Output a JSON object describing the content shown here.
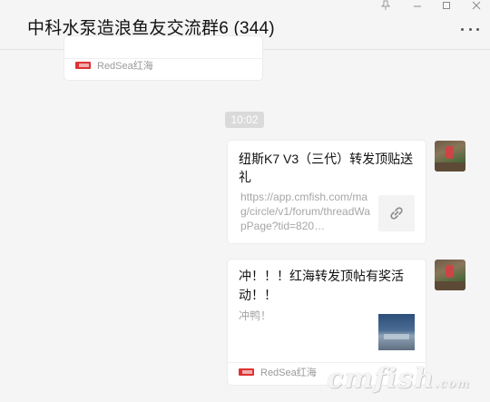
{
  "header": {
    "title": "中科水泵造浪鱼友交流群6 (344)"
  },
  "top_card": {
    "source_name": "RedSea红海"
  },
  "timestamp": "10:02",
  "link_message": {
    "title": "纽斯K7 V3（三代）转发顶贴送礼",
    "url": "https://app.cmfish.com/mag/circle/v1/forum/threadWapPage?tid=820…"
  },
  "article_message": {
    "title": "冲！！！红海转发顶帖有奖活动！！",
    "description": "冲鸭！",
    "source_name": "RedSea红海"
  },
  "watermark": {
    "main": "cmfish",
    "suffix": ".com"
  }
}
